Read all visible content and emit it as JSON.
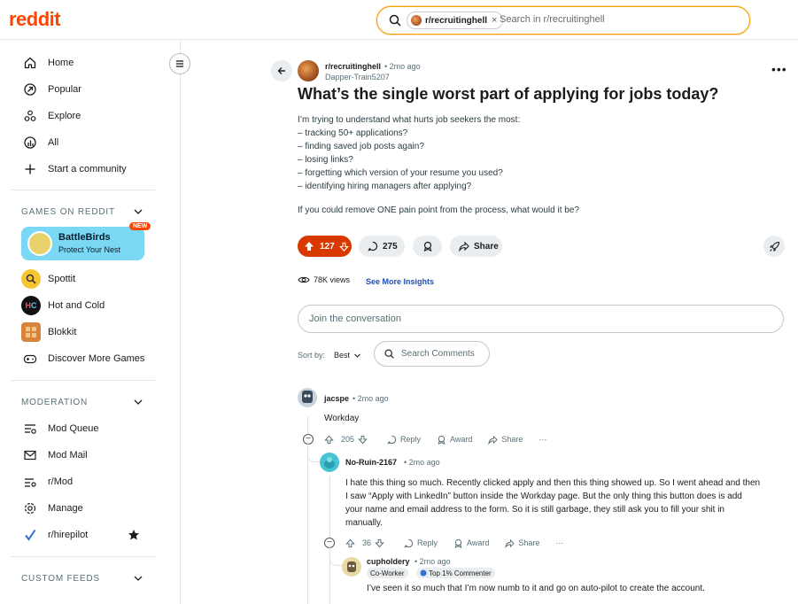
{
  "header": {
    "logo": "reddit",
    "search_chip": "r/recruitinghell",
    "search_chip_close": "×",
    "search_placeholder": "Search in r/recruitinghell"
  },
  "sidebar": {
    "nav": [
      {
        "label": "Home",
        "icon": "home-icon"
      },
      {
        "label": "Popular",
        "icon": "popular-icon"
      },
      {
        "label": "Explore",
        "icon": "explore-icon"
      },
      {
        "label": "All",
        "icon": "all-icon"
      },
      {
        "label": "Start a community",
        "icon": "plus-icon"
      }
    ],
    "games_title": "GAMES ON REDDIT",
    "featured_game": {
      "name": "BattleBirds",
      "subtitle": "Protect Your Nest",
      "badge": "NEW"
    },
    "games": [
      {
        "label": "Spottit",
        "color": "#f7c531"
      },
      {
        "label": "Hot and Cold",
        "color": "#111111"
      },
      {
        "label": "Blokkit",
        "color": "#d9823b"
      },
      {
        "label": "Discover More Games",
        "color": ""
      }
    ],
    "moderation_title": "MODERATION",
    "moderation": [
      {
        "label": "Mod Queue",
        "icon": "mod-queue-icon"
      },
      {
        "label": "Mod Mail",
        "icon": "mail-icon"
      },
      {
        "label": "r/Mod",
        "icon": "mod-icon"
      },
      {
        "label": "Manage",
        "icon": "gear-icon"
      },
      {
        "label": "r/hirepilot",
        "icon": "checkmark-icon"
      }
    ],
    "custom_feeds_title": "CUSTOM FEEDS"
  },
  "post": {
    "subreddit": "r/recruitinghell",
    "time": "• 2mo ago",
    "author": "Dapper-Train5207",
    "title": "What’s the single worst part of applying for jobs today?",
    "body": [
      "I’m trying to understand what hurts job seekers the most:",
      "– tracking 50+ applications?",
      "– finding saved job posts again?",
      "– losing links?",
      "– forgetting which version of your resume you used?",
      "– identifying hiring managers after applying?",
      "If you could remove ONE pain point from the process, what would it be?"
    ],
    "votes": "127",
    "comments": "275",
    "share": "Share",
    "views": "78K views",
    "insights": "See More Insights"
  },
  "comment_box": {
    "placeholder": "Join the conversation",
    "sort_label": "Sort by:",
    "sort_value": "Best",
    "search_comments": "Search Comments"
  },
  "comments": [
    {
      "user": "jacspe",
      "time": "• 2mo ago",
      "lines": [
        "Workday"
      ],
      "votes": "205",
      "reply": "Reply",
      "award": "Award",
      "share": "Share"
    },
    {
      "user": "No-Ruin-2167",
      "time": "• 2mo ago",
      "lines": [
        "I hate this thing so much. Recently clicked apply and then this thing showed up. So I went ahead and then",
        "I saw “Apply with LinkedIn” button inside the Workday page. But the only thing this button does is add",
        "your name and email address to the form. So it is still garbage, they still ask you to fill your shit in",
        "manually."
      ],
      "votes": "36",
      "reply": "Reply",
      "award": "Award",
      "share": "Share"
    },
    {
      "user": "cupholdery",
      "time": "• 2mo ago",
      "flair1": "Co-Worker",
      "flair2": "Top 1% Commenter",
      "lines": [
        "I’ve seen it so much that I’m now numb to it and go on auto-pilot to create the account."
      ]
    }
  ],
  "colors": {
    "accent": "#ff4500",
    "upvoted": "#d93900",
    "link": "#1d50b8"
  }
}
